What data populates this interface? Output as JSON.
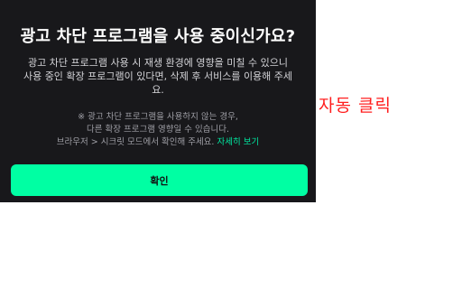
{
  "dialog": {
    "title": "광고 차단 프로그램을 사용 중이신가요?",
    "description_line1": "광고 차단 프로그램 사용 시 재생 환경에 영향을 미칠 수 있으니",
    "description_line2": "사용 중인 확장 프로그램이 있다면, 삭제 후 서비스를 이용해 주세",
    "description_line3": "요.",
    "notice_line1": "※ 광고 차단 프로그램을 사용하지 않는 경우,",
    "notice_line2": "다른 확장 프로그램 영향일 수 있습니다.",
    "notice_line3_prefix": "브라우저 > 시크릿 모드에서 확인해 주세요.",
    "notice_link": "자세히 보기",
    "confirm_label": "확인"
  },
  "annotation": {
    "text": "자동 클릭",
    "color": "#ff1f1f"
  },
  "colors": {
    "dialog_bg": "#18181b",
    "accent": "#00ffa3",
    "link": "#00e7a0"
  }
}
